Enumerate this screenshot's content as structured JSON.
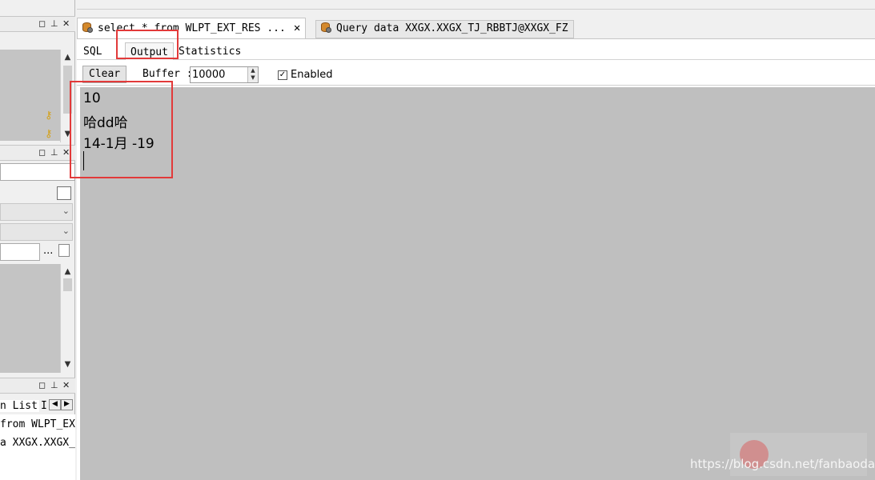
{
  "tabs": [
    {
      "label": "select * from WLPT_EXT_RES ...",
      "close": "✕"
    },
    {
      "label": "Query data XXGX.XXGX_TJ_RBBTJ@XXGX_FZ"
    }
  ],
  "subtabs": [
    "SQL",
    "Output",
    "Statistics"
  ],
  "toolbar": {
    "clear": "Clear",
    "buffer_label": "Buffer :",
    "buffer_value": "10000",
    "enabled_label": "Enabled",
    "enabled_checked": "✓"
  },
  "output": {
    "lines": [
      "10",
      "哈dd哈",
      "14-1月 -19"
    ]
  },
  "left_panel": {
    "list_tab": "n List",
    "list_tab_partial": "I",
    "history": [
      "from WLPT_EX",
      "a XXGX.XXGX_"
    ],
    "ellipsis": "..."
  },
  "watermark": "https://blog.csdn.net/fanbaodan",
  "colors": {
    "highlight": "#e23a3a",
    "output_bg": "#bfbfbf"
  }
}
